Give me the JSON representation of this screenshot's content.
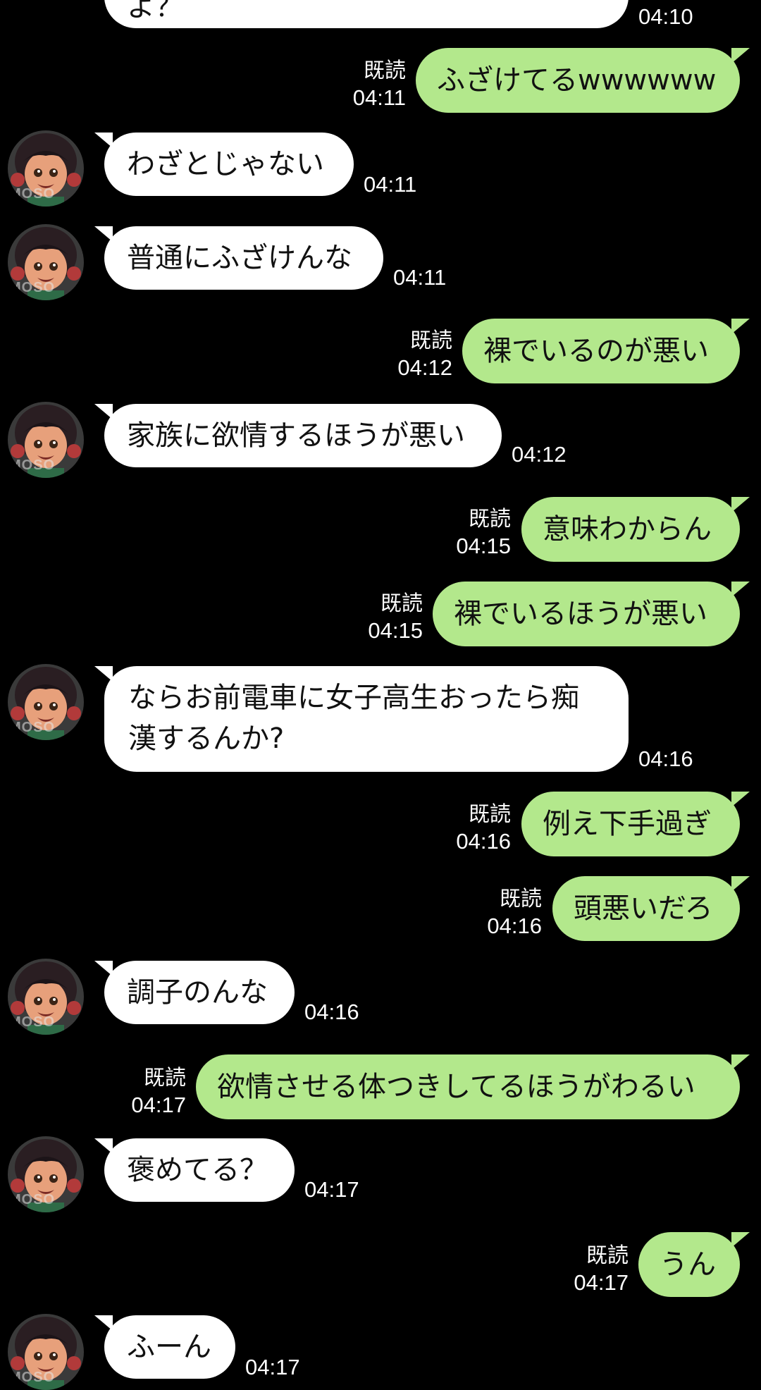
{
  "avatar": {
    "watermark": "MOSO",
    "icon": "cartoon-girl-avatar"
  },
  "colors": {
    "background": "#000000",
    "incoming_bubble": "#ffffff",
    "outgoing_bubble": "#b3e88c"
  },
  "messages": [
    {
      "dir": "in",
      "text": "よ？",
      "time": "04:10"
    },
    {
      "dir": "out",
      "text": "ふざけてるwwwwww",
      "read": "既読",
      "time": "04:11"
    },
    {
      "dir": "in",
      "text": "わざとじゃない",
      "time": "04:11"
    },
    {
      "dir": "in",
      "text": "普通にふざけんな",
      "time": "04:11"
    },
    {
      "dir": "out",
      "text": "裸でいるのが悪い",
      "read": "既読",
      "time": "04:12"
    },
    {
      "dir": "in",
      "text": "家族に欲情するほうが悪い",
      "time": "04:12"
    },
    {
      "dir": "out",
      "text": "意味わからん",
      "read": "既読",
      "time": "04:15"
    },
    {
      "dir": "out",
      "text": "裸でいるほうが悪い",
      "read": "既読",
      "time": "04:15"
    },
    {
      "dir": "in",
      "text": "ならお前電車に女子高生おったら痴漢するんか?",
      "time": "04:16"
    },
    {
      "dir": "out",
      "text": "例え下手過ぎ",
      "read": "既読",
      "time": "04:16"
    },
    {
      "dir": "out",
      "text": "頭悪いだろ",
      "read": "既読",
      "time": "04:16"
    },
    {
      "dir": "in",
      "text": "調子のんな",
      "time": "04:16"
    },
    {
      "dir": "out",
      "text": "欲情させる体つきしてるほうがわるい",
      "read": "既読",
      "time": "04:17"
    },
    {
      "dir": "in",
      "text": "褒めてる？",
      "time": "04:17"
    },
    {
      "dir": "out",
      "text": "うん",
      "read": "既読",
      "time": "04:17"
    },
    {
      "dir": "in",
      "text": "ふーん",
      "time": "04:17"
    }
  ]
}
